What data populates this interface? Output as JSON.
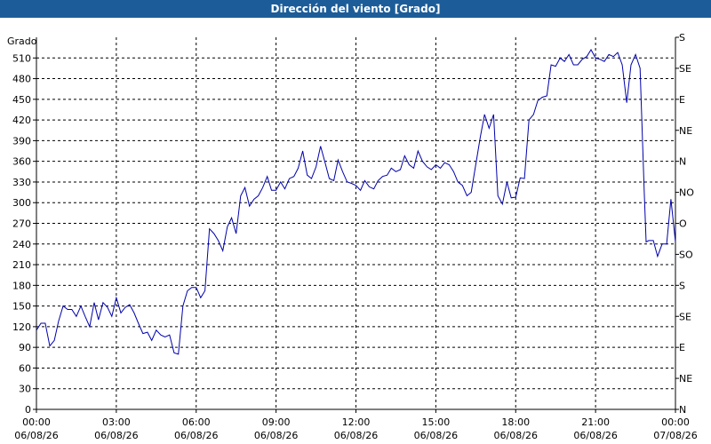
{
  "window": {
    "title": "Dirección del viento [Grado]"
  },
  "chart_data": {
    "type": "line",
    "title": "Dirección del viento [Grado]",
    "ylabel": "Grado",
    "ylim": [
      0,
      540
    ],
    "grid": true,
    "color": "#0000aa",
    "y_ticks": [
      "0",
      "30",
      "60",
      "90",
      "120",
      "150",
      "180",
      "210",
      "240",
      "270",
      "300",
      "330",
      "360",
      "390",
      "420",
      "450",
      "480",
      "510"
    ],
    "right_ticks": [
      {
        "value": 0,
        "label": "N"
      },
      {
        "value": 45,
        "label": "NE"
      },
      {
        "value": 90,
        "label": "E"
      },
      {
        "value": 135,
        "label": "SE"
      },
      {
        "value": 180,
        "label": "S"
      },
      {
        "value": 225,
        "label": "SO"
      },
      {
        "value": 270,
        "label": "O"
      },
      {
        "value": 315,
        "label": "NO"
      },
      {
        "value": 360,
        "label": "N"
      },
      {
        "value": 405,
        "label": "NE"
      },
      {
        "value": 450,
        "label": "E"
      },
      {
        "value": 495,
        "label": "SE"
      },
      {
        "value": 540,
        "label": "S"
      }
    ],
    "x_ticks": [
      {
        "time": "00:00",
        "date": "06/08/26"
      },
      {
        "time": "03:00",
        "date": "06/08/26"
      },
      {
        "time": "06:00",
        "date": "06/08/26"
      },
      {
        "time": "09:00",
        "date": "06/08/26"
      },
      {
        "time": "12:00",
        "date": "06/08/26"
      },
      {
        "time": "15:00",
        "date": "06/08/26"
      },
      {
        "time": "18:00",
        "date": "06/08/26"
      },
      {
        "time": "21:00",
        "date": "06/08/26"
      },
      {
        "time": "00:00",
        "date": "07/08/26"
      }
    ],
    "xlim_hours": [
      0,
      24
    ],
    "series": [
      {
        "points": [
          [
            0.0,
            115
          ],
          [
            0.17,
            125
          ],
          [
            0.33,
            125
          ],
          [
            0.5,
            92
          ],
          [
            0.67,
            100
          ],
          [
            0.83,
            128
          ],
          [
            1.0,
            150
          ],
          [
            1.17,
            145
          ],
          [
            1.33,
            145
          ],
          [
            1.5,
            135
          ],
          [
            1.67,
            150
          ],
          [
            1.83,
            135
          ],
          [
            2.0,
            120
          ],
          [
            2.17,
            155
          ],
          [
            2.33,
            130
          ],
          [
            2.5,
            155
          ],
          [
            2.67,
            148
          ],
          [
            2.83,
            135
          ],
          [
            3.0,
            162
          ],
          [
            3.17,
            140
          ],
          [
            3.33,
            148
          ],
          [
            3.5,
            152
          ],
          [
            3.67,
            140
          ],
          [
            3.83,
            125
          ],
          [
            4.0,
            110
          ],
          [
            4.17,
            112
          ],
          [
            4.33,
            100
          ],
          [
            4.5,
            115
          ],
          [
            4.67,
            108
          ],
          [
            4.83,
            105
          ],
          [
            5.0,
            108
          ],
          [
            5.17,
            82
          ],
          [
            5.33,
            80
          ],
          [
            5.5,
            150
          ],
          [
            5.67,
            172
          ],
          [
            5.83,
            177
          ],
          [
            6.0,
            177
          ],
          [
            6.17,
            162
          ],
          [
            6.33,
            172
          ],
          [
            6.5,
            262
          ],
          [
            6.67,
            255
          ],
          [
            6.83,
            245
          ],
          [
            7.0,
            230
          ],
          [
            7.17,
            265
          ],
          [
            7.33,
            278
          ],
          [
            7.5,
            255
          ],
          [
            7.67,
            310
          ],
          [
            7.83,
            322
          ],
          [
            8.0,
            295
          ],
          [
            8.17,
            305
          ],
          [
            8.33,
            310
          ],
          [
            8.5,
            322
          ],
          [
            8.67,
            338
          ],
          [
            8.83,
            318
          ],
          [
            9.0,
            318
          ],
          [
            9.17,
            330
          ],
          [
            9.33,
            320
          ],
          [
            9.5,
            335
          ],
          [
            9.67,
            338
          ],
          [
            9.83,
            350
          ],
          [
            10.0,
            375
          ],
          [
            10.17,
            340
          ],
          [
            10.33,
            335
          ],
          [
            10.5,
            352
          ],
          [
            10.67,
            382
          ],
          [
            10.83,
            360
          ],
          [
            11.0,
            335
          ],
          [
            11.17,
            332
          ],
          [
            11.33,
            362
          ],
          [
            11.5,
            345
          ],
          [
            11.67,
            330
          ],
          [
            11.83,
            328
          ],
          [
            12.0,
            325
          ],
          [
            12.17,
            318
          ],
          [
            12.33,
            332
          ],
          [
            12.5,
            323
          ],
          [
            12.67,
            320
          ],
          [
            12.83,
            332
          ],
          [
            13.0,
            338
          ],
          [
            13.17,
            340
          ],
          [
            13.33,
            350
          ],
          [
            13.5,
            345
          ],
          [
            13.67,
            348
          ],
          [
            13.83,
            368
          ],
          [
            14.0,
            355
          ],
          [
            14.17,
            350
          ],
          [
            14.33,
            375
          ],
          [
            14.5,
            360
          ],
          [
            14.67,
            352
          ],
          [
            14.83,
            348
          ],
          [
            15.0,
            355
          ],
          [
            15.17,
            350
          ],
          [
            15.33,
            358
          ],
          [
            15.5,
            355
          ],
          [
            15.67,
            345
          ],
          [
            15.83,
            330
          ],
          [
            16.0,
            325
          ],
          [
            16.17,
            310
          ],
          [
            16.33,
            315
          ],
          [
            16.5,
            355
          ],
          [
            16.67,
            395
          ],
          [
            16.83,
            428
          ],
          [
            17.0,
            408
          ],
          [
            17.17,
            428
          ],
          [
            17.33,
            310
          ],
          [
            17.5,
            298
          ],
          [
            17.67,
            330
          ],
          [
            17.83,
            307
          ],
          [
            18.0,
            308
          ],
          [
            18.17,
            336
          ],
          [
            18.33,
            335
          ],
          [
            18.5,
            420
          ],
          [
            18.67,
            428
          ],
          [
            18.83,
            448
          ],
          [
            19.0,
            453
          ],
          [
            19.17,
            455
          ],
          [
            19.33,
            500
          ],
          [
            19.5,
            498
          ],
          [
            19.67,
            510
          ],
          [
            19.83,
            505
          ],
          [
            20.0,
            515
          ],
          [
            20.17,
            500
          ],
          [
            20.33,
            500
          ],
          [
            20.5,
            508
          ],
          [
            20.67,
            512
          ],
          [
            20.83,
            522
          ],
          [
            21.0,
            510
          ],
          [
            21.17,
            508
          ],
          [
            21.33,
            505
          ],
          [
            21.5,
            515
          ],
          [
            21.67,
            512
          ],
          [
            21.83,
            518
          ],
          [
            22.0,
            500
          ],
          [
            22.17,
            445
          ],
          [
            22.33,
            500
          ],
          [
            22.5,
            515
          ],
          [
            22.67,
            495
          ],
          [
            22.83,
            315
          ],
          [
            22.9,
            243
          ],
          [
            23.0,
            245
          ],
          [
            23.17,
            245
          ],
          [
            23.33,
            222
          ],
          [
            23.5,
            240
          ],
          [
            23.67,
            240
          ],
          [
            23.83,
            305
          ],
          [
            24.0,
            243
          ]
        ]
      }
    ]
  }
}
